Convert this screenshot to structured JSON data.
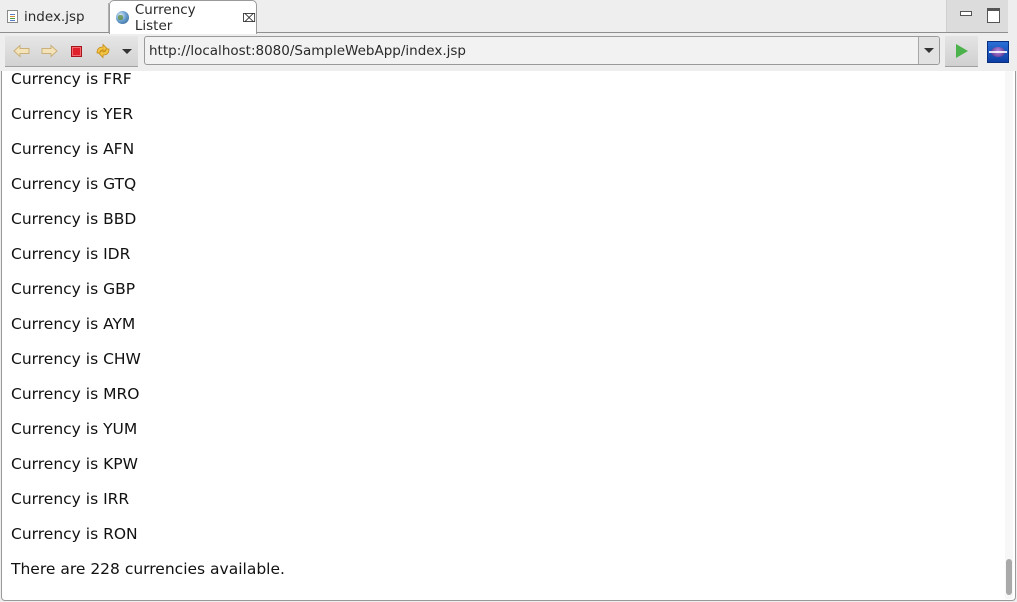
{
  "tabs": [
    {
      "label": "index.jsp",
      "icon": "file-icon",
      "active": false
    },
    {
      "label": "Currency Lister",
      "icon": "globe-icon",
      "active": true,
      "closable": true
    }
  ],
  "window_controls": {
    "minimize": "minimize-icon",
    "maximize": "maximize-icon"
  },
  "toolbar": {
    "back_icon": "back-arrow-icon",
    "forward_icon": "forward-arrow-icon",
    "stop_icon": "stop-icon",
    "refresh_icon": "refresh-icon",
    "url": "http://localhost:8080/SampleWebApp/index.jsp",
    "go_icon": "go-play-icon",
    "eclipse_icon": "eclipse-icon"
  },
  "page": {
    "currencies": [
      "Currency is FRF",
      "Currency is YER",
      "Currency is AFN",
      "Currency is GTQ",
      "Currency is BBD",
      "Currency is IDR",
      "Currency is GBP",
      "Currency is AYM",
      "Currency is CHW",
      "Currency is MRO",
      "Currency is YUM",
      "Currency is KPW",
      "Currency is IRR",
      "Currency is RON"
    ],
    "summary": "There are 228 currencies available."
  },
  "scroll": {
    "position_fraction": 1.0
  }
}
